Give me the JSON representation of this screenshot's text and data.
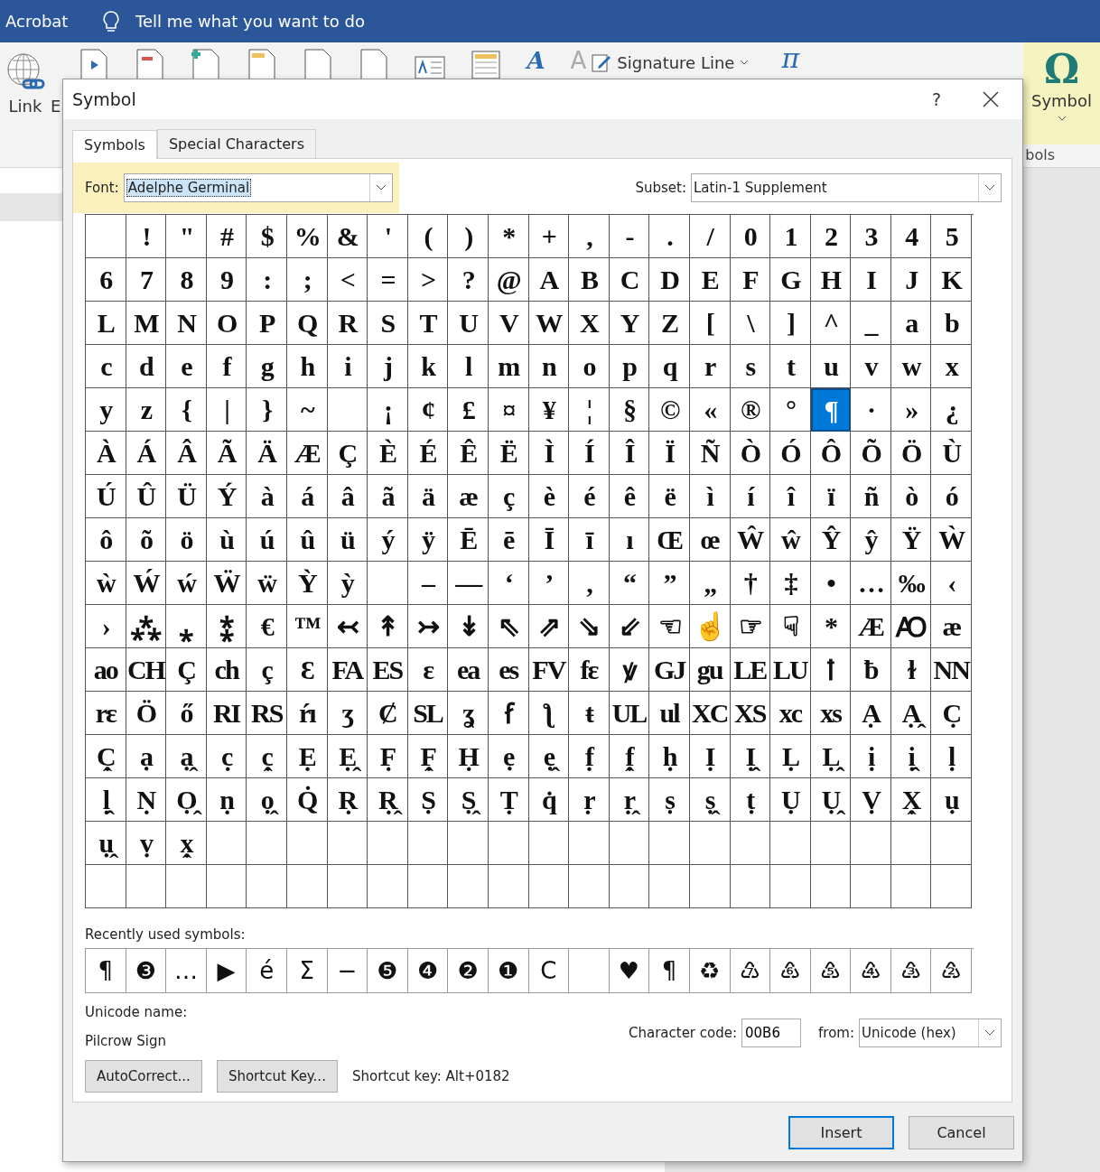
{
  "app_bar": {
    "app_label": "Acrobat",
    "tell_me": "Tell me what you want to do"
  },
  "ribbon": {
    "link_label": "Link",
    "cut_label": "E",
    "wordart_glyph": "A",
    "dropcap_glyph": "A",
    "signature_line": "Signature Line",
    "equation_glyph": "π",
    "symbol_glyph": "Ω",
    "symbol_label": "Symbol",
    "group_label": "bols"
  },
  "dialog": {
    "title": "Symbol",
    "help": "?",
    "tabs": [
      {
        "label": "Symbols",
        "selected": true
      },
      {
        "label": "Special Characters",
        "selected": false
      }
    ],
    "font_label": "Font:",
    "font_value": "Adelphe Germinal",
    "subset_label": "Subset:",
    "subset_value": "Latin-1 Supplement",
    "grid": {
      "rows": [
        {
          "cells": [
            {
              "selected": false
            },
            {
              "char": "!",
              "selected": false
            },
            {
              "char": "\"",
              "selected": false
            },
            {
              "char": "#",
              "selected": false
            },
            {
              "char": "$",
              "selected": false
            },
            {
              "char": "%",
              "selected": false
            },
            {
              "char": "&",
              "selected": false
            },
            {
              "char": "'",
              "selected": false
            },
            {
              "char": "(",
              "selected": false
            },
            {
              "char": ")",
              "selected": false
            },
            {
              "char": "*",
              "selected": false
            },
            {
              "char": "+",
              "selected": false
            },
            {
              "char": ",",
              "selected": false
            },
            {
              "char": "-",
              "selected": false
            },
            {
              "char": ".",
              "selected": false
            },
            {
              "char": "/",
              "selected": false
            },
            {
              "char": "0",
              "selected": false
            },
            {
              "char": "1",
              "selected": false
            },
            {
              "char": "2",
              "selected": false
            },
            {
              "char": "3",
              "selected": false
            },
            {
              "char": "4",
              "selected": false
            },
            {
              "char": "5",
              "selected": false
            }
          ]
        },
        {
          "cells": [
            {
              "char": "6",
              "selected": false
            },
            {
              "char": "7",
              "selected": false
            },
            {
              "char": "8",
              "selected": false
            },
            {
              "char": "9",
              "selected": false
            },
            {
              "char": ":",
              "selected": false
            },
            {
              "char": ";",
              "selected": false
            },
            {
              "char": "<",
              "selected": false
            },
            {
              "char": "=",
              "selected": false
            },
            {
              "char": ">",
              "selected": false
            },
            {
              "char": "?",
              "selected": false
            },
            {
              "char": "@",
              "selected": false
            },
            {
              "char": "A",
              "selected": false
            },
            {
              "char": "B",
              "selected": false
            },
            {
              "char": "C",
              "selected": false
            },
            {
              "char": "D",
              "selected": false
            },
            {
              "char": "E",
              "selected": false
            },
            {
              "char": "F",
              "selected": false
            },
            {
              "char": "G",
              "selected": false
            },
            {
              "char": "H",
              "selected": false
            },
            {
              "char": "I",
              "selected": false
            },
            {
              "char": "J",
              "selected": false
            },
            {
              "char": "K",
              "selected": false
            }
          ]
        },
        {
          "cells": [
            {
              "char": "L",
              "selected": false
            },
            {
              "char": "M",
              "selected": false
            },
            {
              "char": "N",
              "selected": false
            },
            {
              "char": "O",
              "selected": false
            },
            {
              "char": "P",
              "selected": false
            },
            {
              "char": "Q",
              "selected": false
            },
            {
              "char": "R",
              "selected": false
            },
            {
              "char": "S",
              "selected": false
            },
            {
              "char": "T",
              "selected": false
            },
            {
              "char": "U",
              "selected": false
            },
            {
              "char": "V",
              "selected": false
            },
            {
              "char": "W",
              "selected": false
            },
            {
              "char": "X",
              "selected": false
            },
            {
              "char": "Y",
              "selected": false
            },
            {
              "char": "Z",
              "selected": false
            },
            {
              "char": "[",
              "selected": false
            },
            {
              "char": "\\",
              "selected": false
            },
            {
              "char": "]",
              "selected": false
            },
            {
              "char": "^",
              "selected": false
            },
            {
              "char": "_",
              "selected": false
            },
            {
              "char": "a",
              "selected": false
            },
            {
              "char": "b",
              "selected": false
            }
          ]
        },
        {
          "cells": [
            {
              "char": "c",
              "selected": false
            },
            {
              "char": "d",
              "selected": false
            },
            {
              "char": "e",
              "selected": false
            },
            {
              "char": "f",
              "selected": false
            },
            {
              "char": "g",
              "selected": false
            },
            {
              "char": "h",
              "selected": false
            },
            {
              "char": "i",
              "selected": false
            },
            {
              "char": "j",
              "selected": false
            },
            {
              "char": "k",
              "selected": false
            },
            {
              "char": "l",
              "selected": false
            },
            {
              "char": "m",
              "selected": false
            },
            {
              "char": "n",
              "selected": false
            },
            {
              "char": "o",
              "selected": false
            },
            {
              "char": "p",
              "selected": false
            },
            {
              "char": "q",
              "selected": false
            },
            {
              "char": "r",
              "selected": false
            },
            {
              "char": "s",
              "selected": false
            },
            {
              "char": "t",
              "selected": false
            },
            {
              "char": "u",
              "selected": false
            },
            {
              "char": "v",
              "selected": false
            },
            {
              "char": "w",
              "selected": false
            },
            {
              "char": "x",
              "selected": false
            }
          ]
        },
        {
          "cells": [
            {
              "char": "y",
              "selected": false
            },
            {
              "char": "z",
              "selected": false
            },
            {
              "char": "{",
              "selected": false
            },
            {
              "char": "|",
              "selected": false
            },
            {
              "char": "}",
              "selected": false
            },
            {
              "char": "~",
              "selected": false
            },
            {
              "selected": false
            },
            {
              "char": "¡",
              "selected": false
            },
            {
              "char": "¢",
              "selected": false
            },
            {
              "char": "£",
              "selected": false
            },
            {
              "char": "¤",
              "selected": false
            },
            {
              "char": "¥",
              "selected": false
            },
            {
              "char": "¦",
              "selected": false
            },
            {
              "char": "§",
              "selected": false
            },
            {
              "char": "©",
              "selected": false
            },
            {
              "char": "«",
              "selected": false
            },
            {
              "char": "®",
              "selected": false
            },
            {
              "char": "°",
              "selected": false
            },
            {
              "char": "¶",
              "selected": true
            },
            {
              "char": "·",
              "selected": false
            },
            {
              "char": "»",
              "selected": false
            },
            {
              "char": "¿",
              "selected": false
            }
          ]
        },
        {
          "cells": [
            {
              "char": "À",
              "selected": false
            },
            {
              "char": "Á",
              "selected": false
            },
            {
              "char": "Â",
              "selected": false
            },
            {
              "char": "Ã",
              "selected": false
            },
            {
              "char": "Ä",
              "selected": false
            },
            {
              "char": "Æ",
              "selected": false
            },
            {
              "char": "Ç",
              "selected": false
            },
            {
              "char": "È",
              "selected": false
            },
            {
              "char": "É",
              "selected": false
            },
            {
              "char": "Ê",
              "selected": false
            },
            {
              "char": "Ë",
              "selected": false
            },
            {
              "char": "Ì",
              "selected": false
            },
            {
              "char": "Í",
              "selected": false
            },
            {
              "char": "Î",
              "selected": false
            },
            {
              "char": "Ï",
              "selected": false
            },
            {
              "char": "Ñ",
              "selected": false
            },
            {
              "char": "Ò",
              "selected": false
            },
            {
              "char": "Ó",
              "selected": false
            },
            {
              "char": "Ô",
              "selected": false
            },
            {
              "char": "Õ",
              "selected": false
            },
            {
              "char": "Ö",
              "selected": false
            },
            {
              "char": "Ù",
              "selected": false
            }
          ]
        },
        {
          "cells": [
            {
              "char": "Ú",
              "selected": false
            },
            {
              "char": "Û",
              "selected": false
            },
            {
              "char": "Ü",
              "selected": false
            },
            {
              "char": "Ý",
              "selected": false
            },
            {
              "char": "à",
              "selected": false
            },
            {
              "char": "á",
              "selected": false
            },
            {
              "char": "â",
              "selected": false
            },
            {
              "char": "ã",
              "selected": false
            },
            {
              "char": "ä",
              "selected": false
            },
            {
              "char": "æ",
              "selected": false
            },
            {
              "char": "ç",
              "selected": false
            },
            {
              "char": "è",
              "selected": false
            },
            {
              "char": "é",
              "selected": false
            },
            {
              "char": "ê",
              "selected": false
            },
            {
              "char": "ë",
              "selected": false
            },
            {
              "char": "ì",
              "selected": false
            },
            {
              "char": "í",
              "selected": false
            },
            {
              "char": "î",
              "selected": false
            },
            {
              "char": "ï",
              "selected": false
            },
            {
              "char": "ñ",
              "selected": false
            },
            {
              "char": "ò",
              "selected": false
            },
            {
              "char": "ó",
              "selected": false
            }
          ]
        },
        {
          "cells": [
            {
              "char": "ô",
              "selected": false
            },
            {
              "char": "õ",
              "selected": false
            },
            {
              "char": "ö",
              "selected": false
            },
            {
              "char": "ù",
              "selected": false
            },
            {
              "char": "ú",
              "selected": false
            },
            {
              "char": "û",
              "selected": false
            },
            {
              "char": "ü",
              "selected": false
            },
            {
              "char": "ý",
              "selected": false
            },
            {
              "char": "ÿ",
              "selected": false
            },
            {
              "char": "Ē",
              "selected": false
            },
            {
              "char": "ē",
              "selected": false
            },
            {
              "char": "Ī",
              "selected": false
            },
            {
              "char": "ī",
              "selected": false
            },
            {
              "char": "ı",
              "selected": false
            },
            {
              "char": "Œ",
              "selected": false
            },
            {
              "char": "œ",
              "selected": false
            },
            {
              "char": "Ŵ",
              "selected": false
            },
            {
              "char": "ŵ",
              "selected": false
            },
            {
              "char": "Ŷ",
              "selected": false
            },
            {
              "char": "ŷ",
              "selected": false
            },
            {
              "char": "Ÿ",
              "selected": false
            },
            {
              "char": "Ẁ",
              "selected": false
            }
          ]
        },
        {
          "cells": [
            {
              "char": "ẁ",
              "selected": false
            },
            {
              "char": "Ẃ",
              "selected": false
            },
            {
              "char": "ẃ",
              "selected": false
            },
            {
              "char": "Ẅ",
              "selected": false
            },
            {
              "char": "ẅ",
              "selected": false
            },
            {
              "char": "Ỳ",
              "selected": false
            },
            {
              "char": "ỳ",
              "selected": false
            },
            {
              "selected": false
            },
            {
              "char": "–",
              "selected": false
            },
            {
              "char": "—",
              "selected": false
            },
            {
              "char": "‘",
              "selected": false
            },
            {
              "char": "’",
              "selected": false
            },
            {
              "char": "‚",
              "selected": false
            },
            {
              "char": "“",
              "selected": false
            },
            {
              "char": "”",
              "selected": false
            },
            {
              "char": "„",
              "selected": false
            },
            {
              "char": "†",
              "selected": false
            },
            {
              "char": "‡",
              "selected": false
            },
            {
              "char": "•",
              "selected": false
            },
            {
              "char": "…",
              "selected": false
            },
            {
              "char": "‰",
              "selected": false
            },
            {
              "char": "‹",
              "selected": false
            }
          ]
        },
        {
          "cells": [
            {
              "char": "›",
              "selected": false
            },
            {
              "char": "⁂",
              "selected": false
            },
            {
              "char": "⁎",
              "selected": false
            },
            {
              "char": "⁑",
              "selected": false
            },
            {
              "char": "€",
              "selected": false
            },
            {
              "char": "™",
              "selected": false
            },
            {
              "char": "↢",
              "selected": false
            },
            {
              "char": "↟",
              "selected": false
            },
            {
              "char": "↣",
              "selected": false
            },
            {
              "char": "↡",
              "selected": false
            },
            {
              "char": "⇖",
              "selected": false
            },
            {
              "char": "⇗",
              "selected": false
            },
            {
              "char": "⇘",
              "selected": false
            },
            {
              "char": "⇙",
              "selected": false
            },
            {
              "char": "☜",
              "selected": false
            },
            {
              "char": "☝",
              "selected": false
            },
            {
              "char": "☞",
              "selected": false
            },
            {
              "char": "☟",
              "selected": false
            },
            {
              "char": "*",
              "selected": false
            },
            {
              "char": "Æ",
              "selected": false
            },
            {
              "char": "Ꜵ",
              "selected": false
            },
            {
              "char": "æ",
              "selected": false
            }
          ]
        },
        {
          "cells": [
            {
              "char": "ao",
              "selected": false
            },
            {
              "char": "CH",
              "selected": false
            },
            {
              "char": "Ç",
              "selected": false
            },
            {
              "char": "ch",
              "selected": false
            },
            {
              "char": "ç",
              "selected": false
            },
            {
              "char": "Ɛ",
              "selected": false
            },
            {
              "char": "FA",
              "selected": false
            },
            {
              "char": "ES",
              "selected": false
            },
            {
              "char": "ɛ",
              "selected": false
            },
            {
              "char": "ea",
              "selected": false
            },
            {
              "char": "es",
              "selected": false
            },
            {
              "char": "FV",
              "selected": false
            },
            {
              "char": "fɛ",
              "selected": false
            },
            {
              "char": "ꝟ",
              "selected": false
            },
            {
              "char": "GJ",
              "selected": false
            },
            {
              "char": "gu",
              "selected": false
            },
            {
              "char": "LE",
              "selected": false
            },
            {
              "char": "LU",
              "selected": false
            },
            {
              "char": "ꝉ",
              "selected": false
            },
            {
              "char": "ƀ",
              "selected": false
            },
            {
              "char": "ɫ",
              "selected": false
            },
            {
              "char": "NN",
              "selected": false
            }
          ]
        },
        {
          "cells": [
            {
              "char": "rɛ",
              "selected": false
            },
            {
              "char": "Ö",
              "selected": false
            },
            {
              "char": "ő",
              "selected": false
            },
            {
              "char": "RI",
              "selected": false
            },
            {
              "char": "RS",
              "selected": false
            },
            {
              "char": "ŕı",
              "selected": false
            },
            {
              "char": "ʒ",
              "selected": false
            },
            {
              "char": "Ȼ",
              "selected": false
            },
            {
              "char": "SL",
              "selected": false
            },
            {
              "char": "ʓ",
              "selected": false
            },
            {
              "char": "ẜ",
              "selected": false
            },
            {
              "char": "ƪ",
              "selected": false
            },
            {
              "char": "ŧ",
              "selected": false
            },
            {
              "char": "UL",
              "selected": false
            },
            {
              "char": "ul",
              "selected": false
            },
            {
              "char": "XC",
              "selected": false
            },
            {
              "char": "XS",
              "selected": false
            },
            {
              "char": "xc",
              "selected": false
            },
            {
              "char": "xs",
              "selected": false
            },
            {
              "char": "Ạ",
              "selected": false
            },
            {
              "char": "Ạ̭",
              "selected": false
            },
            {
              "char": "C̣",
              "selected": false
            }
          ]
        },
        {
          "cells": [
            {
              "char": "C̣̭",
              "selected": false
            },
            {
              "char": "ạ",
              "selected": false
            },
            {
              "char": "ạ̭",
              "selected": false
            },
            {
              "char": "c̣",
              "selected": false
            },
            {
              "char": "c̣̭",
              "selected": false
            },
            {
              "char": "Ẹ",
              "selected": false
            },
            {
              "char": "Ẹ̭",
              "selected": false
            },
            {
              "char": "F̣",
              "selected": false
            },
            {
              "char": "F̣̭",
              "selected": false
            },
            {
              "char": "Ḥ",
              "selected": false
            },
            {
              "char": "ẹ",
              "selected": false
            },
            {
              "char": "ẹ̭",
              "selected": false
            },
            {
              "char": "f̣",
              "selected": false
            },
            {
              "char": "f̣̭",
              "selected": false
            },
            {
              "char": "ḥ",
              "selected": false
            },
            {
              "char": "Ị",
              "selected": false
            },
            {
              "char": "Ị̭",
              "selected": false
            },
            {
              "char": "Ḷ",
              "selected": false
            },
            {
              "char": "Ḷ̭",
              "selected": false
            },
            {
              "char": "ị",
              "selected": false
            },
            {
              "char": "ị̭",
              "selected": false
            },
            {
              "char": "ḷ",
              "selected": false
            }
          ]
        },
        {
          "cells": [
            {
              "char": "ḷ̭",
              "selected": false
            },
            {
              "char": "Ṇ",
              "selected": false
            },
            {
              "char": "Ọ̭",
              "selected": false
            },
            {
              "char": "ṇ",
              "selected": false
            },
            {
              "char": "ọ̭",
              "selected": false
            },
            {
              "char": "Q̇",
              "selected": false
            },
            {
              "char": "Ṛ",
              "selected": false
            },
            {
              "char": "Ṛ̭",
              "selected": false
            },
            {
              "char": "Ṣ",
              "selected": false
            },
            {
              "char": "Ṣ̭",
              "selected": false
            },
            {
              "char": "Ṭ",
              "selected": false
            },
            {
              "char": "q̇",
              "selected": false
            },
            {
              "char": "ṛ",
              "selected": false
            },
            {
              "char": "ṛ̭",
              "selected": false
            },
            {
              "char": "ṣ",
              "selected": false
            },
            {
              "char": "ṣ̭",
              "selected": false
            },
            {
              "char": "ṭ",
              "selected": false
            },
            {
              "char": "Ụ",
              "selected": false
            },
            {
              "char": "Ụ̭",
              "selected": false
            },
            {
              "char": "Ṿ",
              "selected": false
            },
            {
              "char": "X̣̭",
              "selected": false
            },
            {
              "char": "ụ",
              "selected": false
            }
          ]
        },
        {
          "cells": [
            {
              "char": "ụ̭",
              "selected": false
            },
            {
              "char": "ṿ",
              "selected": false
            },
            {
              "char": "x̣̭",
              "selected": false
            }
          ]
        }
      ]
    },
    "recent_label": "Recently used symbols:",
    "recent": [
      {
        "kind": "char",
        "char": "¶"
      },
      {
        "kind": "char",
        "char": "❸"
      },
      {
        "kind": "char",
        "char": "…"
      },
      {
        "kind": "char",
        "char": "▶"
      },
      {
        "kind": "char",
        "char": "é"
      },
      {
        "kind": "char",
        "char": "Σ"
      },
      {
        "kind": "char",
        "char": "−"
      },
      {
        "kind": "char",
        "char": "❺"
      },
      {
        "kind": "char",
        "char": "❹"
      },
      {
        "kind": "char",
        "char": "❷"
      },
      {
        "kind": "char",
        "char": "❶"
      },
      {
        "kind": "char",
        "char": "C"
      },
      {
        "kind": "blank"
      },
      {
        "kind": "char",
        "char": "♥"
      },
      {
        "kind": "char",
        "char": "¶"
      },
      {
        "kind": "char",
        "char": "♻"
      },
      {
        "kind": "char",
        "char": "♹"
      },
      {
        "kind": "char",
        "char": "♸"
      },
      {
        "kind": "char",
        "char": "♷"
      },
      {
        "kind": "char",
        "char": "♶"
      },
      {
        "kind": "char",
        "char": "♵"
      },
      {
        "kind": "char",
        "char": "♴"
      }
    ],
    "unicode_name_label": "Unicode name:",
    "unicode_name": "Pilcrow Sign",
    "char_code_label": "Character code:",
    "char_code": "00B6",
    "from_label": "from:",
    "from_value": "Unicode (hex)",
    "autocorrect_button": "AutoCorrect...",
    "shortcut_button": "Shortcut Key...",
    "shortcut_text": "Shortcut key: Alt+0182",
    "insert_button": "Insert",
    "cancel_button": "Cancel"
  }
}
